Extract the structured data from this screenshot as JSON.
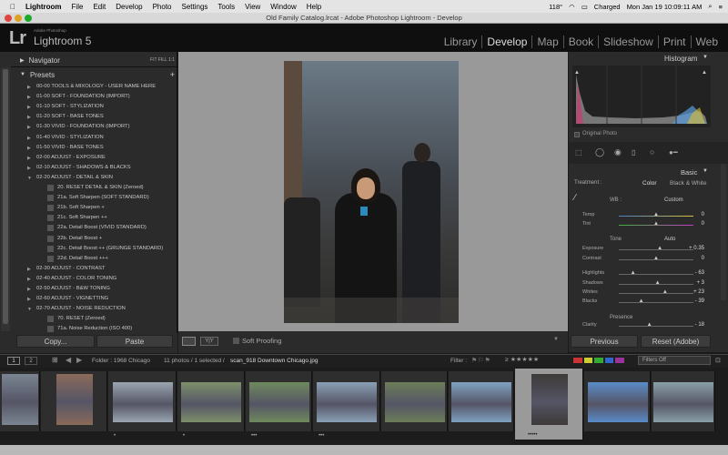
{
  "mac_menubar": {
    "apple": "",
    "app": "Lightroom",
    "items": [
      "File",
      "Edit",
      "Develop",
      "Photo",
      "Settings",
      "Tools",
      "View",
      "Window",
      "Help"
    ],
    "temp": "118°",
    "battery": "Charged",
    "datetime": "Mon Jan 19  10:09:11 AM"
  },
  "window_title": "Old Family Catalog.lrcat - Adobe Photoshop Lightroom - Develop",
  "branding": {
    "logo": "Lr",
    "sub": "Adobe Photoshop",
    "name": "Lightroom 5"
  },
  "modules": [
    "Library",
    "Develop",
    "Map",
    "Book",
    "Slideshow",
    "Print",
    "Web"
  ],
  "left": {
    "navigator": "Navigator",
    "nav_options": "FIT  FILL  1:1  ",
    "presets_title": "Presets",
    "presets": [
      {
        "label": "00-00 TOOLS & MIXOLOGY - USER NAME HERE",
        "type": "folder"
      },
      {
        "label": "01-00 SOFT - FOUNDATION (IMPORT)",
        "type": "folder"
      },
      {
        "label": "01-10 SOFT - STYLIZATION",
        "type": "folder"
      },
      {
        "label": "01-20 SOFT - BASE TONES",
        "type": "folder"
      },
      {
        "label": "01-30 VIVID - FOUNDATION (IMPORT)",
        "type": "folder"
      },
      {
        "label": "01-40 VIVID - STYLIZATION",
        "type": "folder"
      },
      {
        "label": "01-50 VIVID - BASE TONES",
        "type": "folder"
      },
      {
        "label": "02-00 ADJUST - EXPOSURE",
        "type": "folder"
      },
      {
        "label": "02-10 ADJUST - SHADOWS & BLACKS",
        "type": "folder"
      },
      {
        "label": "02-20 ADJUST - DETAIL & SKIN",
        "type": "open"
      },
      {
        "label": "20. RESET DETAIL & SKIN (Zeroed)",
        "type": "item"
      },
      {
        "label": "21a. Soft Sharpen (SOFT STANDARD)",
        "type": "item"
      },
      {
        "label": "21b. Soft Sharpen +",
        "type": "item"
      },
      {
        "label": "21c. Soft Sharpen ++",
        "type": "item"
      },
      {
        "label": "22a. Detail Boost (VIVID STANDARD)",
        "type": "item"
      },
      {
        "label": "22b. Detail Boost +",
        "type": "item"
      },
      {
        "label": "22c. Detail Boost ++ (GRUNGE STANDARD)",
        "type": "item"
      },
      {
        "label": "22d. Detail Boost +++",
        "type": "item"
      },
      {
        "label": "02-30 ADJUST - CONTRAST",
        "type": "folder"
      },
      {
        "label": "02-40 ADJUST - COLOR TONING",
        "type": "folder"
      },
      {
        "label": "02-50 ADJUST - B&W TONING",
        "type": "folder"
      },
      {
        "label": "02-60 ADJUST - VIGNETTING",
        "type": "folder"
      },
      {
        "label": "02-70 ADJUST - NOISE REDUCTION",
        "type": "open"
      },
      {
        "label": "70. RESET (Zeroed)",
        "type": "item"
      },
      {
        "label": "71a. Noise Reduction (ISO 400)",
        "type": "item"
      }
    ],
    "copy_btn": "Copy...",
    "paste_btn": "Paste"
  },
  "toolbar": {
    "soft_proofing": "Soft Proofing"
  },
  "right": {
    "histogram": "Histogram",
    "original_photo": "Original Photo",
    "basic": "Basic",
    "treatment_label": "Treatment :",
    "treatment_color": "Color",
    "treatment_bw": "Black & White",
    "wb_label": "WB :",
    "wb_value": "Custom",
    "tone_label": "Tone",
    "auto": "Auto",
    "presence_label": "Presence",
    "sliders": [
      {
        "label": "Temp",
        "value": "0",
        "pos": 0.5
      },
      {
        "label": "Tint",
        "value": "0",
        "pos": 0.5
      },
      {
        "label": "Exposure",
        "value": "+ 0.35",
        "pos": 0.55
      },
      {
        "label": "Contrast",
        "value": "0",
        "pos": 0.5
      },
      {
        "label": "Highlights",
        "value": "- 63",
        "pos": 0.19
      },
      {
        "label": "Shadows",
        "value": "+ 3",
        "pos": 0.52
      },
      {
        "label": "Whites",
        "value": "+ 23",
        "pos": 0.62
      },
      {
        "label": "Blacks",
        "value": "- 39",
        "pos": 0.3
      },
      {
        "label": "Clarity",
        "value": "- 18",
        "pos": 0.41
      }
    ],
    "previous_btn": "Previous",
    "reset_btn": "Reset (Adobe)"
  },
  "bottom": {
    "page1": "1",
    "page2": "2",
    "folder": "Folder : 1968 Chicago",
    "count": "11 photos / 1 selected /",
    "filename": "scan_918 Downtown Chicago.jpg",
    "filter": "Filter :",
    "filters_off": "Filters Off"
  },
  "filmstrip": {
    "stars": [
      "",
      "",
      "•",
      "•",
      "•••",
      "•••",
      "",
      "",
      "•••••",
      "",
      ""
    ],
    "colors": [
      "#7a8592",
      "#8b6a5a",
      "#9aa5b0",
      "#7d8f6a",
      "#6f8a5c",
      "#8aa0b5",
      "#6c7d58",
      "#7fa2c0",
      "#3d3a38",
      "#5a8bc8",
      "#8aa0a8"
    ]
  }
}
